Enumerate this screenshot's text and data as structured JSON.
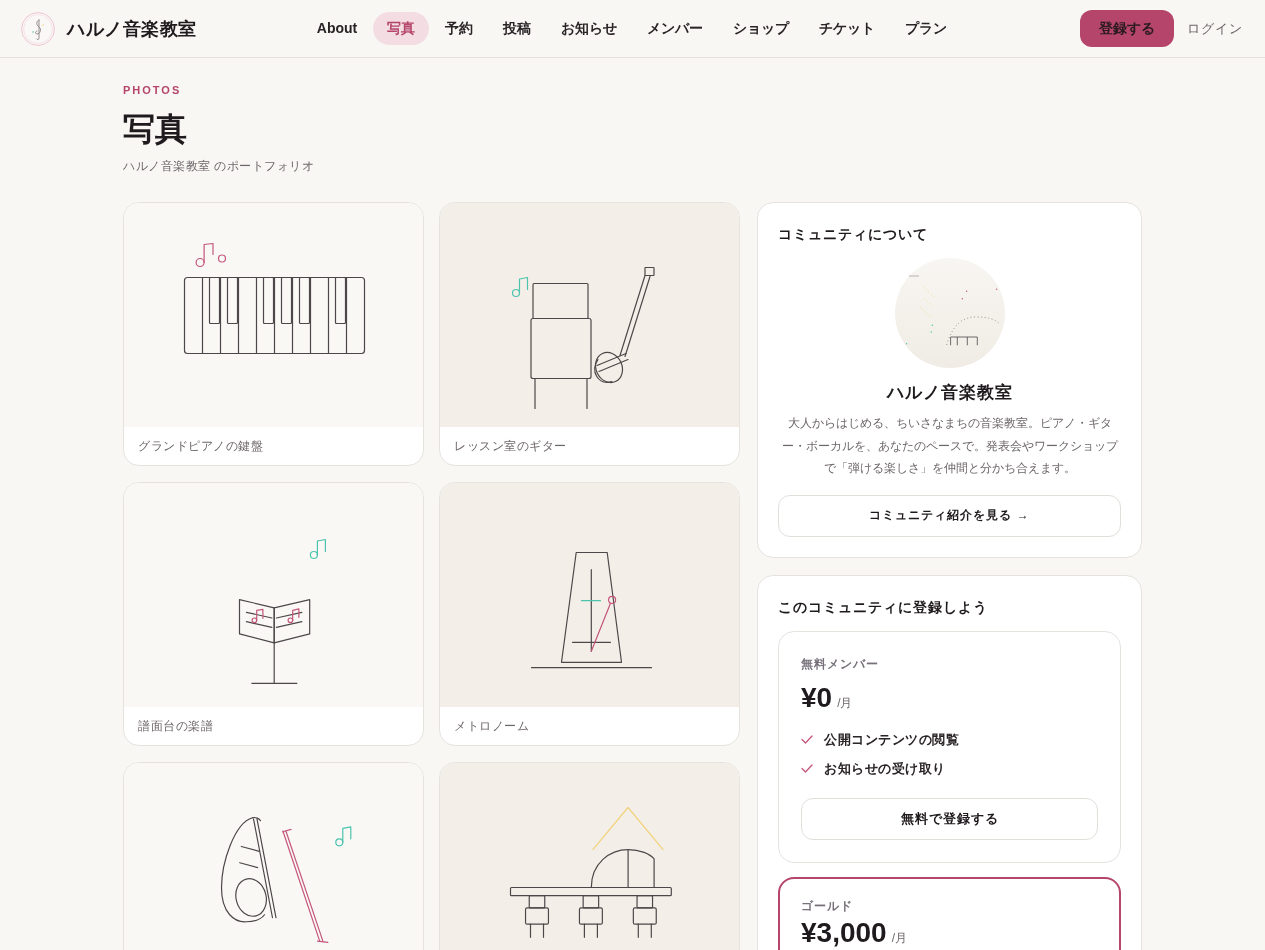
{
  "header": {
    "brand": "ハルノ音楽教室",
    "nav": [
      {
        "label": "About",
        "selected": false
      },
      {
        "label": "写真",
        "selected": true
      },
      {
        "label": "予約",
        "selected": false
      },
      {
        "label": "投稿",
        "selected": false
      },
      {
        "label": "お知らせ",
        "selected": false
      },
      {
        "label": "メンバー",
        "selected": false
      },
      {
        "label": "ショップ",
        "selected": false
      },
      {
        "label": "チケット",
        "selected": false
      },
      {
        "label": "プラン",
        "selected": false
      }
    ],
    "signup_button": "登録する",
    "login_link": "ログイン"
  },
  "page": {
    "eyebrow": "PHOTOS",
    "title": "写真",
    "subtitle": "ハルノ音楽教室 のポートフォリオ"
  },
  "photos": [
    {
      "kind": "piano",
      "caption": "グランドピアノの鍵盤"
    },
    {
      "kind": "guitar",
      "caption": "レッスン室のギター"
    },
    {
      "kind": "music_stand",
      "caption": "譜面台の楽譜"
    },
    {
      "kind": "metronome",
      "caption": "メトロノーム"
    },
    {
      "kind": "violin"
    },
    {
      "kind": "stage"
    }
  ],
  "about": {
    "title": "コミュニティについて",
    "name": "ハルノ音楽教室",
    "description": "大人からはじめる、ちいさなまちの音楽教室。ピアノ・ギター・ボーカルを、あなたのペースで。発表会やワークショップで「弾ける楽しさ」を仲間と分かち合えます。",
    "button": "コミュニティ紹介を見る →"
  },
  "plans_section": {
    "title": "このコミュニティに登録しよう",
    "plans": [
      {
        "name": "無料メンバー",
        "price": "¥0",
        "period": "/月",
        "featured": false,
        "features": [
          "公開コンテンツの閲覧",
          "お知らせの受け取り"
        ],
        "button": "無料で登録する"
      },
      {
        "name": "ゴールド",
        "price": "¥3,000",
        "period": "/月",
        "featured": true
      }
    ]
  }
}
